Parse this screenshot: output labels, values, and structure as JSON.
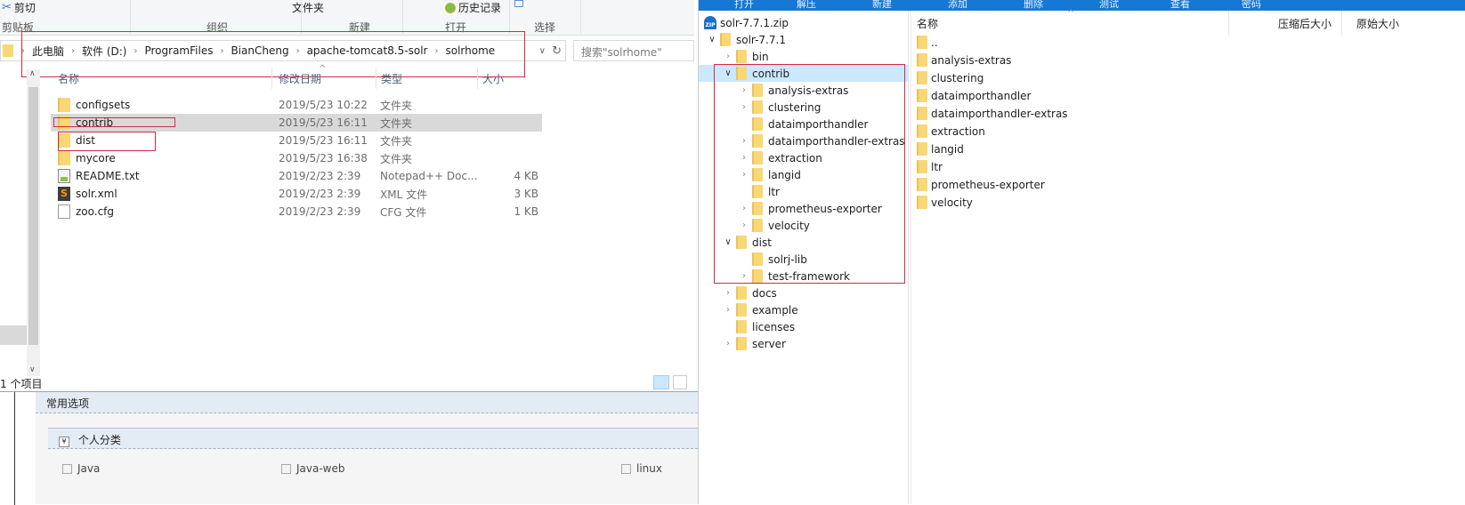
{
  "left_explorer": {
    "ribbon": {
      "commands": {
        "cut": "剪切",
        "new_folder": "文件夹",
        "history": "历史记录"
      },
      "groups": [
        "剪贴板",
        "组织",
        "新建",
        "打开",
        "选择"
      ]
    },
    "address": {
      "crumbs": [
        "此电脑",
        "软件 (D:)",
        "ProgramFiles",
        "BianCheng",
        "apache-tomcat8.5-solr",
        "solrhome"
      ],
      "search_placeholder": "搜索\"solrhome\""
    },
    "columns": {
      "name": "名称",
      "date": "修改日期",
      "type": "类型",
      "size": "大小"
    },
    "files": [
      {
        "name": "configsets",
        "date": "2019/5/23 10:22",
        "type": "文件夹",
        "size": "",
        "icon": "folder-icon"
      },
      {
        "name": "contrib",
        "date": "2019/5/23 16:11",
        "type": "文件夹",
        "size": "",
        "icon": "folder-icon",
        "selected": true
      },
      {
        "name": "dist",
        "date": "2019/5/23 16:11",
        "type": "文件夹",
        "size": "",
        "icon": "folder-icon"
      },
      {
        "name": "mycore",
        "date": "2019/5/23 16:38",
        "type": "文件夹",
        "size": "",
        "icon": "folder-icon"
      },
      {
        "name": "README.txt",
        "date": "2019/2/23 2:39",
        "type": "Notepad++ Doc...",
        "size": "4 KB",
        "icon": "notepad-file-icon"
      },
      {
        "name": "solr.xml",
        "date": "2019/2/23 2:39",
        "type": "XML 文件",
        "size": "3 KB",
        "icon": "sublime-file-icon"
      },
      {
        "name": "zoo.cfg",
        "date": "2019/2/23 2:39",
        "type": "CFG 文件",
        "size": "1 KB",
        "icon": "blank-file-icon"
      }
    ],
    "status": "1 个项目"
  },
  "blog_form": {
    "common_options": "常用选项",
    "personal_category": "个人分类",
    "categories": [
      "Java",
      "Java-web",
      "linux"
    ]
  },
  "zip_app": {
    "toolbar": [
      "打开",
      "解压",
      "新建",
      "添加",
      "删除",
      "测试",
      "查看",
      "密码"
    ],
    "tree": [
      {
        "label": "solr-7.7.1.zip",
        "level": 0,
        "icon": "zip-icon",
        "chevron": ""
      },
      {
        "label": "solr-7.7.1",
        "level": 1,
        "icon": "folder-icon",
        "chevron": "open"
      },
      {
        "label": "bin",
        "level": 2,
        "icon": "folder-icon",
        "chevron": "closed"
      },
      {
        "label": "contrib",
        "level": 2,
        "icon": "folder-icon",
        "chevron": "open",
        "selected": true
      },
      {
        "label": "analysis-extras",
        "level": 3,
        "icon": "folder-icon",
        "chevron": "closed"
      },
      {
        "label": "clustering",
        "level": 3,
        "icon": "folder-icon",
        "chevron": "closed"
      },
      {
        "label": "dataimporthandler",
        "level": 3,
        "icon": "folder-icon",
        "chevron": ""
      },
      {
        "label": "dataimporthandler-extras",
        "level": 3,
        "icon": "folder-icon",
        "chevron": "closed"
      },
      {
        "label": "extraction",
        "level": 3,
        "icon": "folder-icon",
        "chevron": "closed"
      },
      {
        "label": "langid",
        "level": 3,
        "icon": "folder-icon",
        "chevron": "closed"
      },
      {
        "label": "ltr",
        "level": 3,
        "icon": "folder-icon",
        "chevron": ""
      },
      {
        "label": "prometheus-exporter",
        "level": 3,
        "icon": "folder-icon",
        "chevron": "closed"
      },
      {
        "label": "velocity",
        "level": 3,
        "icon": "folder-icon",
        "chevron": "closed"
      },
      {
        "label": "dist",
        "level": 2,
        "icon": "folder-icon",
        "chevron": "open"
      },
      {
        "label": "solrj-lib",
        "level": 3,
        "icon": "folder-icon",
        "chevron": ""
      },
      {
        "label": "test-framework",
        "level": 3,
        "icon": "folder-icon",
        "chevron": "closed"
      },
      {
        "label": "docs",
        "level": 2,
        "icon": "folder-icon",
        "chevron": "closed"
      },
      {
        "label": "example",
        "level": 2,
        "icon": "folder-icon",
        "chevron": "closed"
      },
      {
        "label": "licenses",
        "level": 2,
        "icon": "folder-icon",
        "chevron": ""
      },
      {
        "label": "server",
        "level": 2,
        "icon": "folder-icon",
        "chevron": "closed"
      }
    ],
    "list_columns": {
      "name": "名称",
      "compressed": "压缩后大小",
      "original": "原始大小"
    },
    "list": [
      "..",
      "analysis-extras",
      "clustering",
      "dataimporthandler",
      "dataimporthandler-extras",
      "extraction",
      "langid",
      "ltr",
      "prometheus-exporter",
      "velocity"
    ]
  }
}
